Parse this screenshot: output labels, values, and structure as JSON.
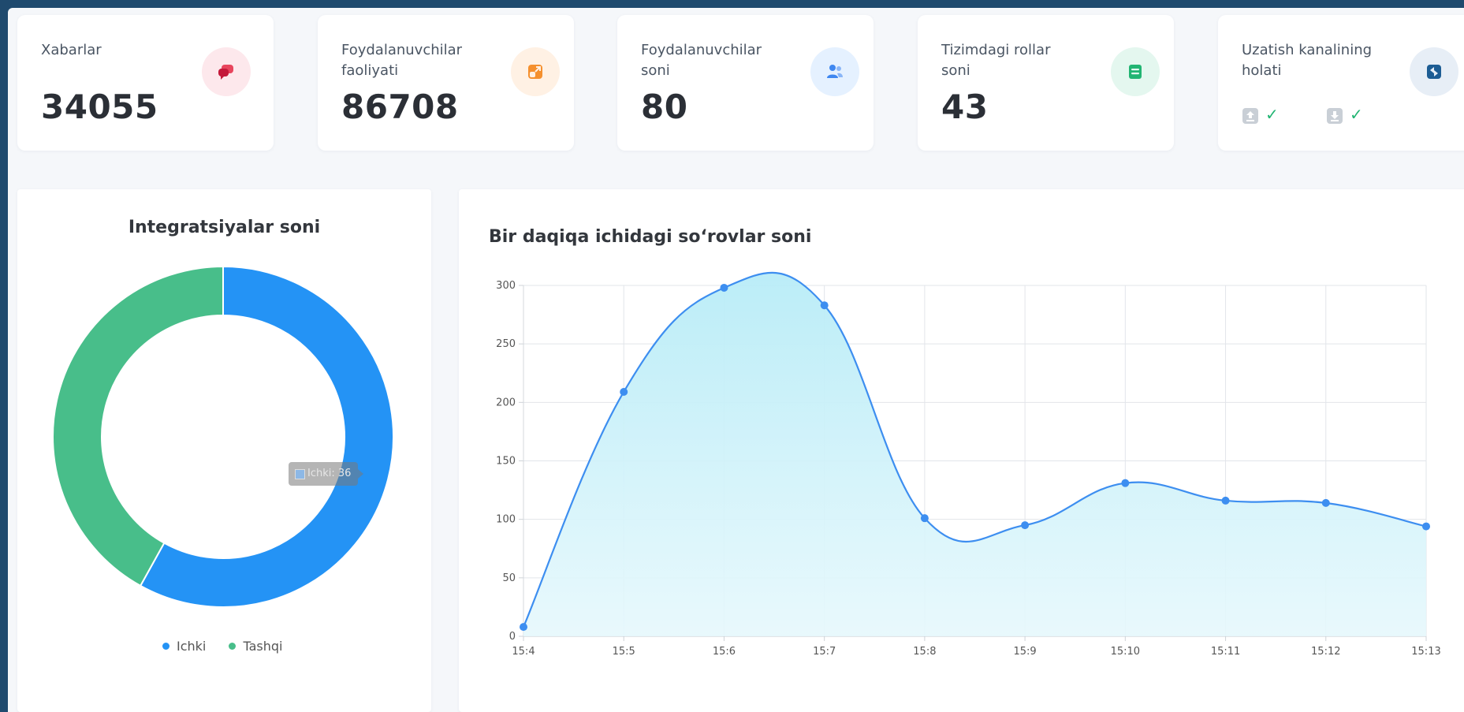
{
  "cards": [
    {
      "title": "Xabarlar",
      "value": "34055",
      "icon": "chat-icon",
      "icon_bg": "#fde8ec",
      "icon_color": "#e8455d"
    },
    {
      "title": "Foydalanuvchilar faoliyati",
      "value": "86708",
      "icon": "activity-icon",
      "icon_bg": "#fff1e4",
      "icon_color": "#f5902e"
    },
    {
      "title": "Foydalanuvchilar soni",
      "value": "80",
      "icon": "users-icon",
      "icon_bg": "#e5f1ff",
      "icon_color": "#3f87f0"
    },
    {
      "title": "Tizimdagi rollar soni",
      "value": "43",
      "icon": "roles-icon",
      "icon_bg": "#e4f7ef",
      "icon_color": "#22b573"
    },
    {
      "title": "Uzatish kanalining holati",
      "icon": "channel-icon",
      "icon_bg": "#e7eef6",
      "icon_color": "#1d5d94",
      "status": [
        {
          "icon": "upload-icon",
          "ok": "✓"
        },
        {
          "icon": "download-icon",
          "ok": "✓"
        }
      ]
    }
  ],
  "pie": {
    "title": "Integratsiyalar soni",
    "tooltip": "Ichki: 36",
    "chart_data": {
      "type": "pie",
      "categories": [
        "Ichki",
        "Tashqi"
      ],
      "values": [
        36,
        26
      ],
      "colors": [
        "#2493f5",
        "#48be8a"
      ],
      "legend": "bottom"
    }
  },
  "line": {
    "title": "Bir daqiqa ichidagi soʻrovlar soni",
    "chart_data": {
      "type": "area",
      "x": [
        "15:4",
        "15:5",
        "15:6",
        "15:7",
        "15:8",
        "15:9",
        "15:10",
        "15:11",
        "15:12",
        "15:13"
      ],
      "values": [
        8,
        209,
        298,
        283,
        101,
        95,
        131,
        116,
        114,
        94
      ],
      "ylim": [
        0,
        300
      ],
      "yticks": [
        0,
        50,
        100,
        150,
        200,
        250,
        300
      ],
      "line_color": "#3d8ef0",
      "grid": true
    }
  }
}
